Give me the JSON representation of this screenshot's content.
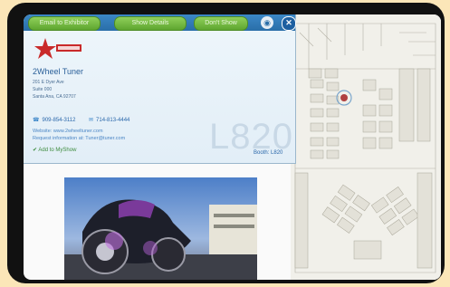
{
  "toolbar": {
    "btn1": "Email to Exhibitor",
    "btn2": "Show Details",
    "btn3": "Don't Show",
    "view_icon": "eye-icon",
    "close_icon": "close-icon"
  },
  "exhibitor": {
    "logo_icon": "star-logo",
    "name": "2Wheel Tuner",
    "address1": "201 E Dyer Ave",
    "address2": "Suite 000",
    "address3": "Santa Ana, CA 92707",
    "phone": "909-854-3112",
    "fax": "714-813-4444",
    "website": "Website: www.2wheeltuner.com",
    "email": "Request information at: Tuner@tuner.com",
    "favorite": "Add to MyShow",
    "booth_watermark": "L820",
    "booth_link": "Booth: L820"
  },
  "colors": {
    "toolbar": "#2a6ea8",
    "button": "#6ab13a",
    "link": "#2a67aa"
  }
}
